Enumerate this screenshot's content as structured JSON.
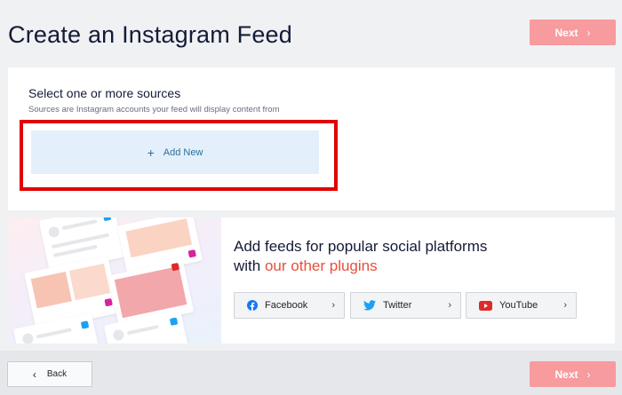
{
  "header": {
    "title": "Create an Instagram Feed",
    "next_label": "Next"
  },
  "sources": {
    "title": "Select one or more sources",
    "description": "Sources are Instagram accounts your feed will display content from",
    "add_new_label": "Add New"
  },
  "plugins": {
    "headline_part1": "Add feeds for popular social platforms with ",
    "headline_accent": "our other plugins",
    "buttons": [
      {
        "label": "Facebook",
        "icon": "facebook-icon",
        "color": "#1877f2"
      },
      {
        "label": "Twitter",
        "icon": "twitter-icon",
        "color": "#1da1f2"
      },
      {
        "label": "YouTube",
        "icon": "youtube-icon",
        "color": "#e02a2a"
      }
    ]
  },
  "footer": {
    "back_label": "Back",
    "next_label": "Next"
  },
  "colors": {
    "next_button": "#f79b9e",
    "accent_text": "#e6503c",
    "highlight": "#e00000",
    "add_new_bg": "#e3f0fb"
  }
}
